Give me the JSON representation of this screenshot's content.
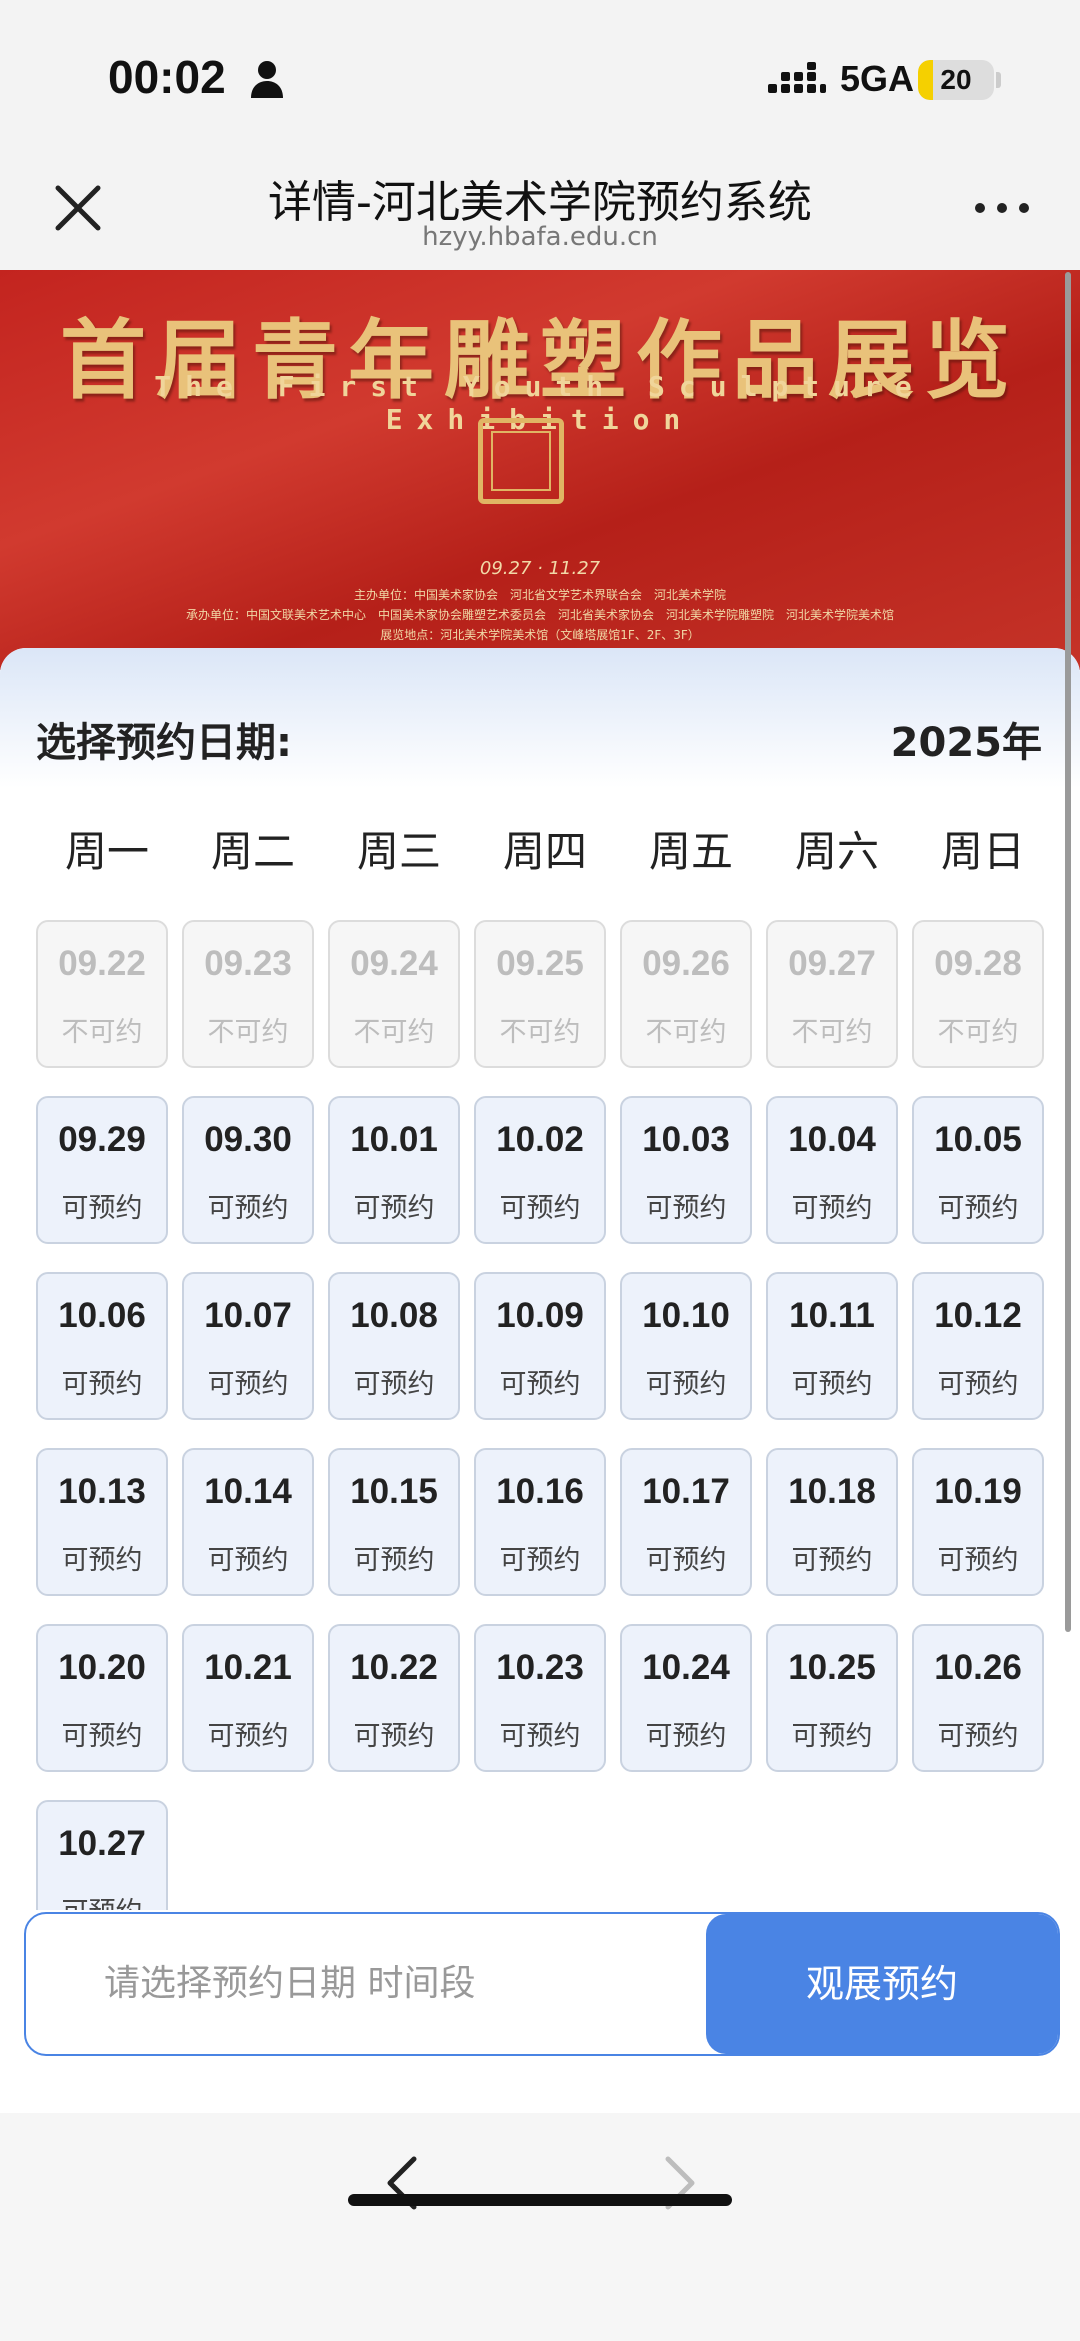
{
  "status_bar": {
    "time": "00:02",
    "network": "5GA",
    "battery_level": "20",
    "battery_fraction": 0.2,
    "accent_colors": {
      "battery": "#f5d000"
    }
  },
  "nav": {
    "title": "详情-河北美术学院预约系统",
    "url": "hzyy.hbafa.edu.cn",
    "icons": {
      "close": "close-icon",
      "more": "more-icon"
    }
  },
  "banner": {
    "title": "首届青年雕塑作品展览",
    "subtitle": "The First Youth Sculpture Exhibition",
    "seal_text": "",
    "dates": "09.27 · 11.27",
    "organizers": "主办单位：中国美术家协会　河北省文学艺术界联合会　河北美术学院",
    "co_organizers": "承办单位：中国文联美术艺术中心　中国美术家协会雕塑艺术委员会　河北省美术家协会　河北美术学院雕塑院　河北美术学院美术馆",
    "venue": "展览地点：河北美术学院美术馆（文峰塔展馆1F、2F、3F）"
  },
  "booking": {
    "label": "选择预约日期:",
    "year": "2025年",
    "weekdays": [
      "周一",
      "周二",
      "周三",
      "周四",
      "周五",
      "周六",
      "周日"
    ],
    "days": [
      {
        "date": "09.22",
        "status": "不可约",
        "available": false
      },
      {
        "date": "09.23",
        "status": "不可约",
        "available": false
      },
      {
        "date": "09.24",
        "status": "不可约",
        "available": false
      },
      {
        "date": "09.25",
        "status": "不可约",
        "available": false
      },
      {
        "date": "09.26",
        "status": "不可约",
        "available": false
      },
      {
        "date": "09.27",
        "status": "不可约",
        "available": false
      },
      {
        "date": "09.28",
        "status": "不可约",
        "available": false
      },
      {
        "date": "09.29",
        "status": "可预约",
        "available": true
      },
      {
        "date": "09.30",
        "status": "可预约",
        "available": true
      },
      {
        "date": "10.01",
        "status": "可预约",
        "available": true
      },
      {
        "date": "10.02",
        "status": "可预约",
        "available": true
      },
      {
        "date": "10.03",
        "status": "可预约",
        "available": true
      },
      {
        "date": "10.04",
        "status": "可预约",
        "available": true
      },
      {
        "date": "10.05",
        "status": "可预约",
        "available": true
      },
      {
        "date": "10.06",
        "status": "可预约",
        "available": true
      },
      {
        "date": "10.07",
        "status": "可预约",
        "available": true
      },
      {
        "date": "10.08",
        "status": "可预约",
        "available": true
      },
      {
        "date": "10.09",
        "status": "可预约",
        "available": true
      },
      {
        "date": "10.10",
        "status": "可预约",
        "available": true
      },
      {
        "date": "10.11",
        "status": "可预约",
        "available": true
      },
      {
        "date": "10.12",
        "status": "可预约",
        "available": true
      },
      {
        "date": "10.13",
        "status": "可预约",
        "available": true
      },
      {
        "date": "10.14",
        "status": "可预约",
        "available": true
      },
      {
        "date": "10.15",
        "status": "可预约",
        "available": true
      },
      {
        "date": "10.16",
        "status": "可预约",
        "available": true
      },
      {
        "date": "10.17",
        "status": "可预约",
        "available": true
      },
      {
        "date": "10.18",
        "status": "可预约",
        "available": true
      },
      {
        "date": "10.19",
        "status": "可预约",
        "available": true
      },
      {
        "date": "10.20",
        "status": "可预约",
        "available": true
      },
      {
        "date": "10.21",
        "status": "可预约",
        "available": true
      },
      {
        "date": "10.22",
        "status": "可预约",
        "available": true
      },
      {
        "date": "10.23",
        "status": "可预约",
        "available": true
      },
      {
        "date": "10.24",
        "status": "可预约",
        "available": true
      },
      {
        "date": "10.25",
        "status": "可预约",
        "available": true
      },
      {
        "date": "10.26",
        "status": "可预约",
        "available": true
      },
      {
        "date": "10.27",
        "status": "可预约",
        "available": true
      }
    ]
  },
  "action": {
    "placeholder": "请选择预约日期 时间段",
    "button_label": "观展预约",
    "accent_color": "#4a84e4"
  },
  "toolbar": {
    "icons": {
      "back": "chevron-left-icon",
      "forward": "chevron-right-icon"
    }
  }
}
